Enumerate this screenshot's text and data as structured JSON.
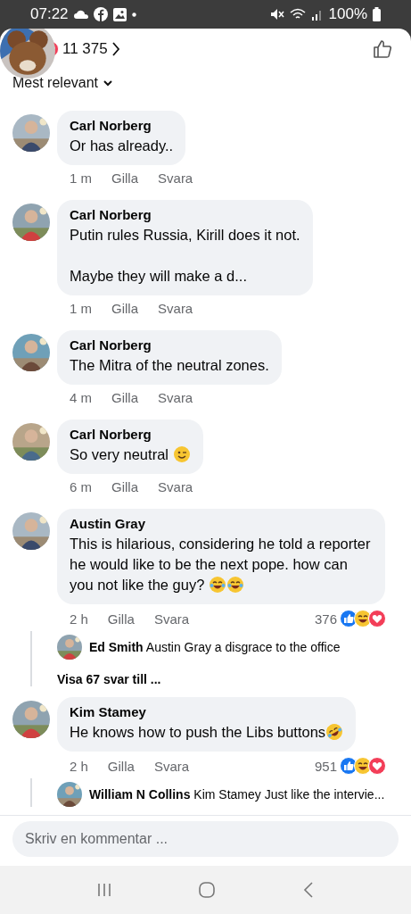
{
  "status_bar": {
    "time": "07:22",
    "battery": "100%"
  },
  "header": {
    "reaction_count": "11 375",
    "sort": "Mest relevant"
  },
  "comments": [
    {
      "author": "Carl Norberg",
      "text": "Or has already..",
      "time": "1 m",
      "actions": [
        "Gilla",
        "Svara"
      ]
    },
    {
      "author": "Carl Norberg",
      "text": "Putin rules Russia, Kirill does it not.\n\nMaybe they will make a d...",
      "time": "1 m",
      "actions": [
        "Gilla",
        "Svara"
      ]
    },
    {
      "author": "Carl Norberg",
      "text": "The Mitra of the neutral zones.",
      "time": "4 m",
      "actions": [
        "Gilla",
        "Svara"
      ]
    },
    {
      "author": "Carl Norberg",
      "text": "So very neutral ",
      "emojis": [
        {
          "kind": "wink"
        }
      ],
      "time": "6 m",
      "actions": [
        "Gilla",
        "Svara"
      ]
    },
    {
      "author": "Austin Gray",
      "text": "This is hilarious, considering he told a reporter he would like to be the next pope. how can you not like the guy? ",
      "emojis": [
        {
          "kind": "joy"
        },
        {
          "kind": "joy"
        }
      ],
      "time": "2 h",
      "actions": [
        "Gilla",
        "Svara"
      ],
      "reaction_count": "376",
      "reactions": [
        {
          "kind": "like"
        },
        {
          "kind": "haha"
        },
        {
          "kind": "love"
        }
      ],
      "replies": [
        {
          "author": "Ed Smith",
          "text": "Austin Gray a disgrace to the office"
        }
      ],
      "more_replies": "Visa 67 svar till ..."
    },
    {
      "author": "Kim Stamey",
      "text": "He knows how to push the Libs buttons",
      "emojis": [
        {
          "kind": "rofl"
        }
      ],
      "time": "2 h",
      "actions": [
        "Gilla",
        "Svara"
      ],
      "reaction_count": "951",
      "reactions": [
        {
          "kind": "like"
        },
        {
          "kind": "haha"
        },
        {
          "kind": "love"
        }
      ],
      "replies": [
        {
          "author": "William N Collins",
          "text": "Kim Stamey Just like the intervie..."
        }
      ]
    }
  ],
  "composer": {
    "placeholder": "Skriv en kommentar ..."
  }
}
